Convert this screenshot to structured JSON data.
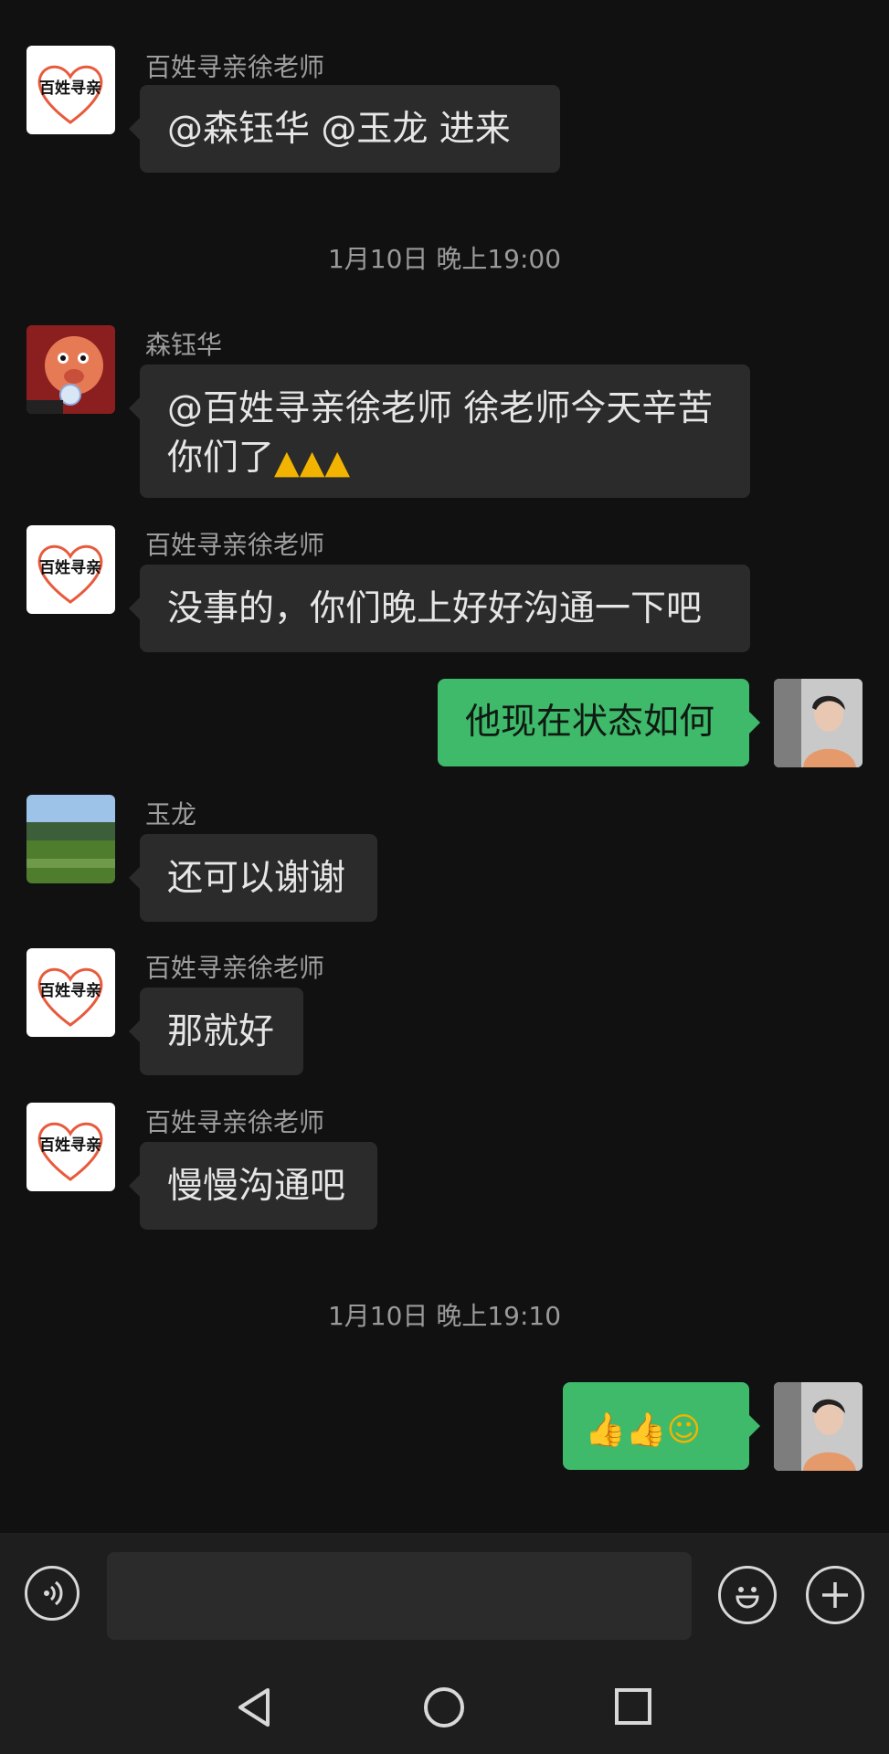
{
  "messages": [
    {
      "sender": "百姓寻亲徐老师",
      "text": "@森钰华 @玉龙  进来"
    },
    {
      "timestamp": "1月10日 晚上19:00"
    },
    {
      "sender": "森钰华",
      "line1": "@百姓寻亲徐老师  徐老师今天辛苦",
      "line2": "你们了"
    },
    {
      "sender": "百姓寻亲徐老师",
      "text": "没事的，你们晚上好好沟通一下吧"
    },
    {
      "me": true,
      "text": "他现在状态如何"
    },
    {
      "sender": "玉龙",
      "text": "还可以谢谢"
    },
    {
      "sender": "百姓寻亲徐老师",
      "text": "那就好"
    },
    {
      "sender": "百姓寻亲徐老师",
      "text": "慢慢沟通吧"
    },
    {
      "timestamp": "1月10日 晚上19:10"
    },
    {
      "me": true,
      "emoji": "thumbs-up thumbs-up grinning-face"
    }
  ],
  "logo_text": "百姓寻亲",
  "input": {
    "placeholder": ""
  },
  "icons": {
    "voice": "voice-icon",
    "emoji": "emoji-icon",
    "plus": "plus-icon",
    "back": "back-triangle-icon",
    "home": "home-circle-icon",
    "recents": "recents-square-icon"
  },
  "colors": {
    "background": "#111111",
    "bubble_in": "#2b2b2b",
    "bubble_out": "#3fb96a",
    "bar": "#1e1e1e"
  }
}
